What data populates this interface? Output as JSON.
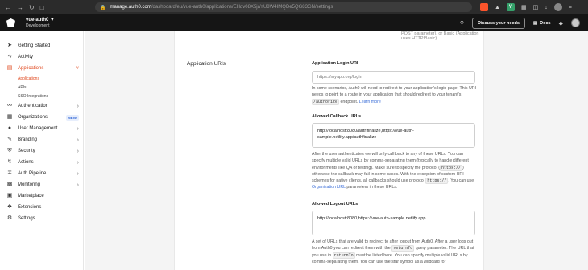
{
  "browser": {
    "url_host": "manage.auth0.com",
    "url_path": "/dashboard/eu/vue-auth0/applications/EHdv08X5jaYU8W4IMQDe5QG83GN/settings"
  },
  "header": {
    "tenant_name": "vue-auth0",
    "tenant_env": "Development",
    "discuss_label": "Discuss your needs",
    "docs_label": "Docs"
  },
  "sidebar": {
    "items": [
      {
        "label": "Getting Started",
        "icon": "rocket-icon"
      },
      {
        "label": "Activity",
        "icon": "activity-icon"
      },
      {
        "label": "Applications",
        "icon": "layers-icon"
      },
      {
        "label": "Authentication",
        "icon": "key-icon"
      },
      {
        "label": "Organizations",
        "icon": "organization-icon",
        "badge": "NEW"
      },
      {
        "label": "User Management",
        "icon": "users-icon"
      },
      {
        "label": "Branding",
        "icon": "brush-icon"
      },
      {
        "label": "Security",
        "icon": "shield-icon"
      },
      {
        "label": "Actions",
        "icon": "lightning-icon"
      },
      {
        "label": "Auth Pipeline",
        "icon": "pipeline-icon"
      },
      {
        "label": "Monitoring",
        "icon": "chart-icon"
      },
      {
        "label": "Marketplace",
        "icon": "store-icon"
      },
      {
        "label": "Extensions",
        "icon": "extensions-icon"
      },
      {
        "label": "Settings",
        "icon": "gear-icon"
      }
    ],
    "sub_items": [
      "Applications",
      "APIs",
      "SSO Integrations"
    ]
  },
  "content": {
    "top_faded_text": "POST parameter), or Basic (Application uses HTTP Basic).",
    "section_title": "Application URIs",
    "login_uri": {
      "label": "Application Login URI",
      "placeholder": "https://myapp.org/login",
      "help_1": "In some scenarios, Auth0 will need to redirect to your application's login page. This URI needs to point to a route in your application that should redirect to your tenant's ",
      "help_code": "/authorize",
      "help_2": " endpoint. ",
      "help_link": "Learn more"
    },
    "callback": {
      "label": "Allowed Callback URLs",
      "value": "http://localhost:8080/authfinalize,https://vue-auth-sample.netlify.app/authfinalize",
      "help_1": "After the user authenticates we will only call back to any of these URLs. You can specify multiple valid URLs by comma-separating them (typically to handle different environments like QA or testing). Make sure to specify the protocol (",
      "help_code1": "https://",
      "help_2": ") otherwise the callback may fail in some cases. With the exception of custom URI schemes for native clients, all callbacks should use protocol ",
      "help_code2": "https://",
      "help_3": ". You can use ",
      "help_link": "Organization URL",
      "help_4": " parameters in these URLs."
    },
    "logout": {
      "label": "Allowed Logout URLs",
      "value": "http://localhost:8080,https://vue-auth-sample.netlify.app",
      "help_1": "A set of URLs that are valid to redirect to after logout from Auth0. After a user logs out from Auth0 you can redirect them with the ",
      "help_code1": "returnTo",
      "help_2": " query parameter. The URL that you use in ",
      "help_code2": "returnTo",
      "help_3": " must be listed here. You can specify multiple valid URLs by comma-separating them. You can use the star symbol as a wildcard for"
    }
  }
}
